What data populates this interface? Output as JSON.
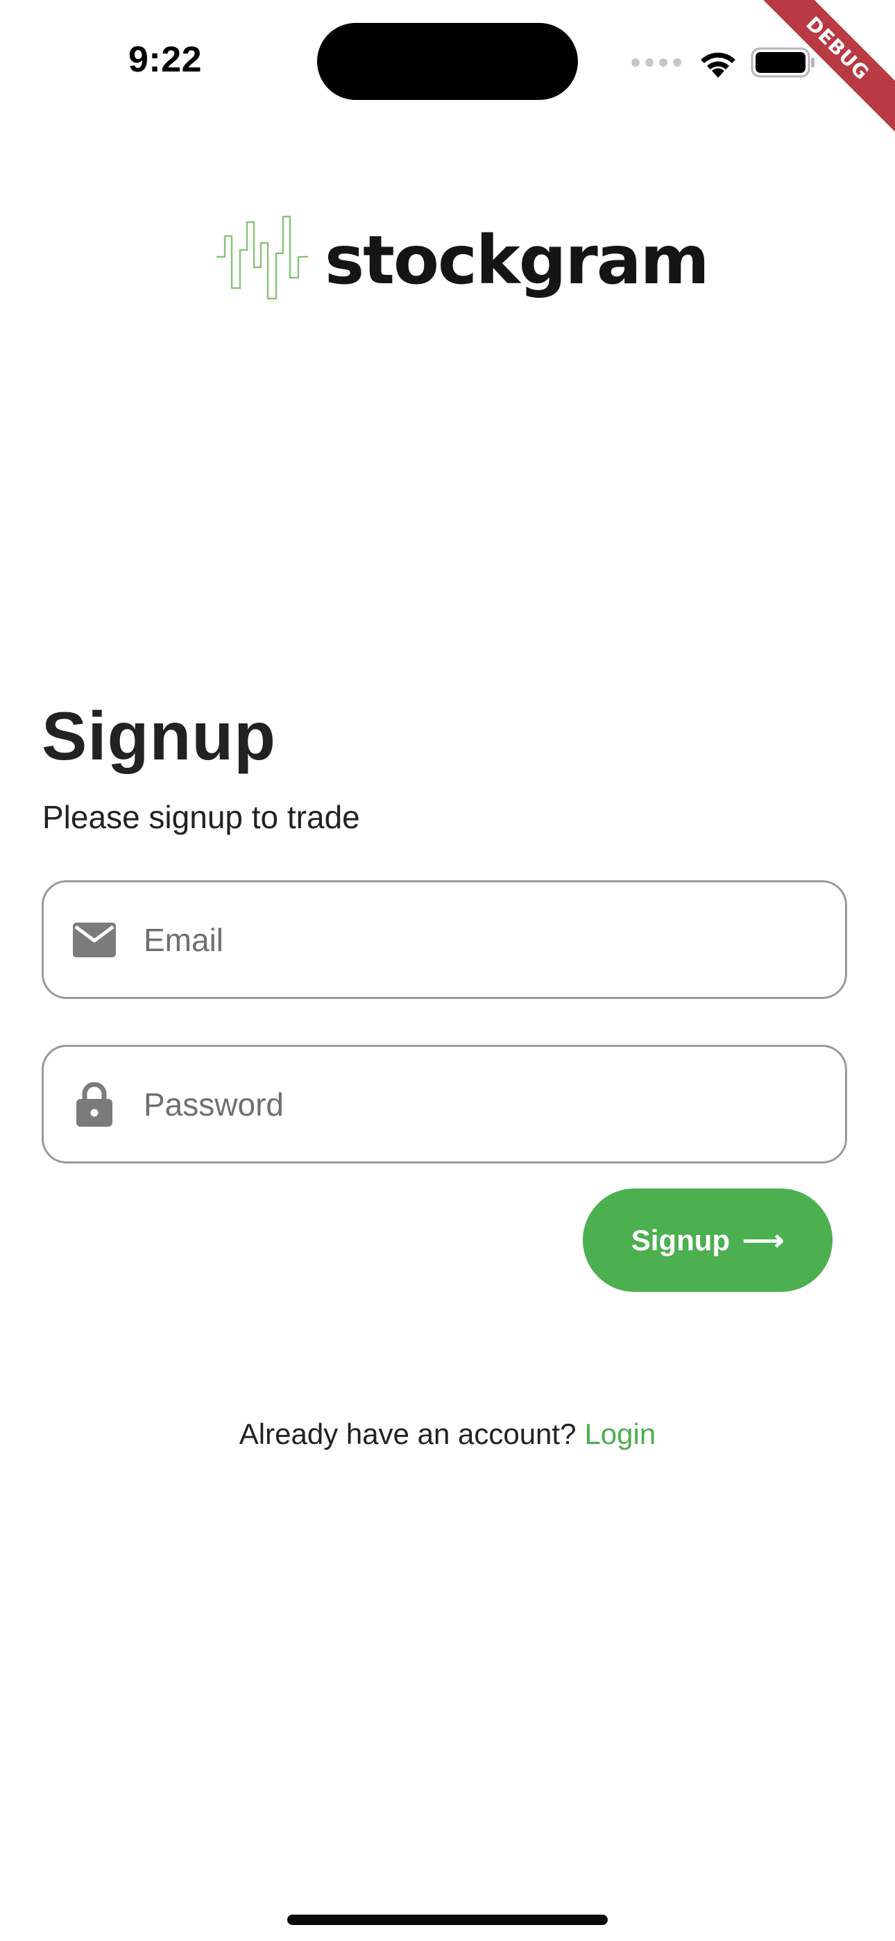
{
  "status_bar": {
    "time": "9:22",
    "icons": [
      "cellular-signal-icon",
      "wifi-icon",
      "battery-icon"
    ]
  },
  "debug_banner": {
    "label": "DEBUG",
    "color": "#b83a43"
  },
  "logo": {
    "text": "stockgram",
    "mark_icon": "stock-bars-icon",
    "mark_color": "#8bc17e"
  },
  "form": {
    "title": "Signup",
    "subtitle": "Please signup to trade",
    "email": {
      "placeholder": "Email",
      "value": "",
      "icon": "email-icon"
    },
    "password": {
      "placeholder": "Password",
      "value": "",
      "icon": "lock-icon"
    },
    "submit_label": "Signup",
    "submit_arrow": "⟶",
    "accent_color": "#4caf50"
  },
  "footer": {
    "prompt": "Already have an account?",
    "link_label": "Login"
  }
}
